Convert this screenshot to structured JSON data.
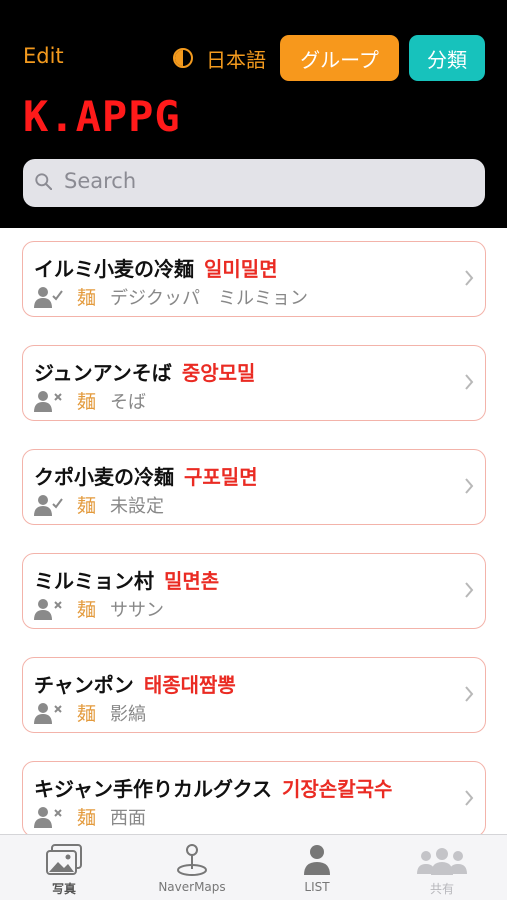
{
  "header": {
    "edit": "Edit",
    "language": "日本語",
    "group_button": "グループ",
    "category_button": "分類",
    "app_title": "K.APPG"
  },
  "search": {
    "placeholder": "Search"
  },
  "items": [
    {
      "name_ja": "イルミ小麦の冷麺",
      "name_ko": "일미밀면",
      "category": "麺",
      "area": "デジクッパ　ミルミョン",
      "status": "check"
    },
    {
      "name_ja": "ジュンアンそば",
      "name_ko": "중앙모밀",
      "category": "麺",
      "area": "そば",
      "status": "cross"
    },
    {
      "name_ja": "クポ小麦の冷麺",
      "name_ko": "구포밀면",
      "category": "麺",
      "area": "未設定",
      "status": "check"
    },
    {
      "name_ja": "ミルミョン村",
      "name_ko": "밀면촌",
      "category": "麺",
      "area": "ササン",
      "status": "cross"
    },
    {
      "name_ja": "チャンポン",
      "name_ko": "태종대짬뽕",
      "category": "麺",
      "area": "影縞",
      "status": "cross"
    },
    {
      "name_ja": "キジャン手作りカルグクス",
      "name_ko": "기장손칼국수",
      "category": "麺",
      "area": "西面",
      "status": "cross"
    }
  ],
  "tabs": [
    {
      "label": "写真",
      "icon": "photo-icon"
    },
    {
      "label": "NaverMaps",
      "icon": "map-pin-icon"
    },
    {
      "label": "LIST",
      "icon": "person-icon"
    },
    {
      "label": "共有",
      "icon": "group-icon"
    }
  ],
  "colors": {
    "accent_orange": "#f7981c",
    "accent_teal": "#17c2bc",
    "title_red": "#ff1a1a",
    "korean_red": "#ea2b23",
    "card_border": "#f3b3aa"
  }
}
